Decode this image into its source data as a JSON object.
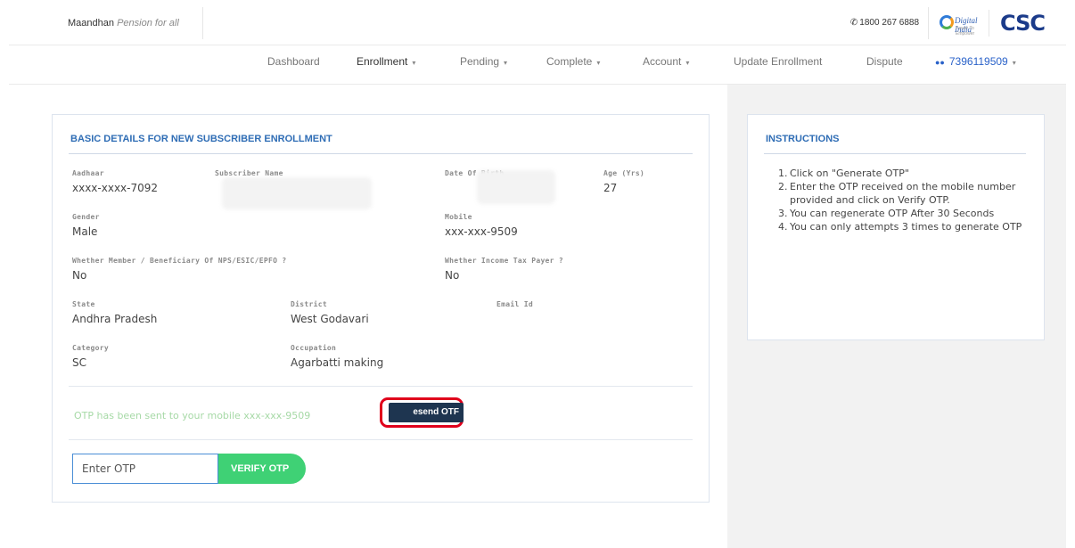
{
  "header": {
    "brand_name": "Maandhan",
    "brand_tagline": "Pension for all",
    "phone": "1800 267 6888",
    "digital_india": "Digital India",
    "digital_india_sub": "Power To Empower",
    "csc_logo": "CSC"
  },
  "nav": {
    "items": [
      {
        "label": "Dashboard",
        "dropdown": false
      },
      {
        "label": "Enrollment",
        "dropdown": true
      },
      {
        "label": "Pending",
        "dropdown": true
      },
      {
        "label": "Complete",
        "dropdown": true
      },
      {
        "label": "Account",
        "dropdown": true
      },
      {
        "label": "Update Enrollment",
        "dropdown": false
      },
      {
        "label": "Dispute",
        "dropdown": false
      }
    ],
    "user": "7396119509",
    "caret": "▾"
  },
  "form": {
    "title": "BASIC DETAILS FOR NEW SUBSCRIBER ENROLLMENT",
    "fields": {
      "aadhaar": {
        "label": "Aadhaar",
        "value": "xxxx-xxxx-7092"
      },
      "subscriber_name": {
        "label": "Subscriber Name",
        "value": ""
      },
      "dob": {
        "label": "Date Of Birth",
        "value": ""
      },
      "age": {
        "label": "Age (Yrs)",
        "value": "27"
      },
      "gender": {
        "label": "Gender",
        "value": "Male"
      },
      "mobile": {
        "label": "Mobile",
        "value": "xxx-xxx-9509"
      },
      "member": {
        "label": "Whether Member / Beneficiary Of NPS/ESIC/EPFO ?",
        "value": "No"
      },
      "income_tax": {
        "label": "Whether Income Tax Payer ?",
        "value": "No"
      },
      "state": {
        "label": "State",
        "value": "Andhra Pradesh"
      },
      "district": {
        "label": "District",
        "value": "West Godavari"
      },
      "email": {
        "label": "Email Id",
        "value": ""
      },
      "category": {
        "label": "Category",
        "value": "SC"
      },
      "occupation": {
        "label": "Occupation",
        "value": "Agarbatti making"
      }
    },
    "otp_message": "OTP has been sent to your mobile xxx-xxx-9509",
    "resend_label": "esend OTF",
    "otp_placeholder": "Enter OTP",
    "verify_label": "VERIFY OTP"
  },
  "instructions": {
    "title": "INSTRUCTIONS",
    "items": [
      {
        "num": "1.",
        "text": "Click on \"Generate OTP\""
      },
      {
        "num": "2.",
        "text": "Enter the OTP received on the mobile number provided and click on Verify OTP."
      },
      {
        "num": "3.",
        "text": "You can regenerate OTP After 30 Seconds"
      },
      {
        "num": "4.",
        "text": "You can only attempts 3 times to generate OTP"
      }
    ]
  },
  "colors": {
    "accent_blue": "#2f6db5",
    "verify_green": "#3fd175",
    "resend_dark": "#1e3550",
    "highlight_red": "#e0001b"
  }
}
